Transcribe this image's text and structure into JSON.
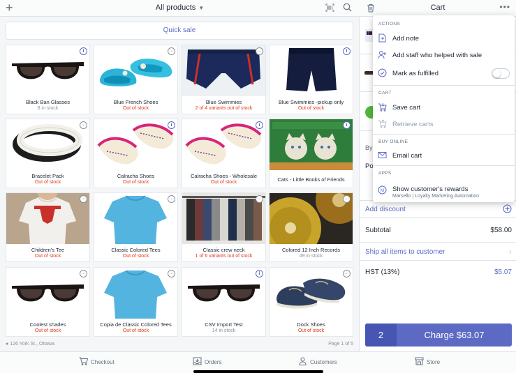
{
  "header": {
    "add_symbol": "+",
    "products_title": "All products",
    "caret": "▼"
  },
  "quick_sale_label": "Quick sale",
  "products": [
    {
      "name": "Black Ban Glasses",
      "stock": "8 in stock",
      "out": false,
      "badge": "info",
      "img": "sunglasses"
    },
    {
      "name": "Blue French Shoes",
      "stock": "Out of stock",
      "out": true,
      "badge": "more",
      "img": "blueshoes"
    },
    {
      "name": "Blue Swimmies",
      "stock": "2 of 4 variants out of stock",
      "out": true,
      "badge": "more",
      "img": "swimmies"
    },
    {
      "name": "Blue Swimmies -pickup only",
      "stock": "Out of stock",
      "out": true,
      "badge": "info",
      "img": "shorts"
    },
    {
      "name": "Bracelet Pack",
      "stock": "Out of stock",
      "out": true,
      "badge": "more",
      "img": "bracelet"
    },
    {
      "name": "Calracha Shoes",
      "stock": "Out of stock",
      "out": true,
      "badge": "info",
      "img": "pinkshoes"
    },
    {
      "name": "Calracha Shoes - Wholesale",
      "stock": "Out of stock",
      "out": true,
      "badge": "info",
      "img": "pinkshoes"
    },
    {
      "name": "Cats - Little Books of Friends",
      "stock": "",
      "out": false,
      "badge": "info",
      "img": "cats"
    },
    {
      "name": "Children's Tee",
      "stock": "Out of stock",
      "out": true,
      "badge": "more",
      "img": "tee"
    },
    {
      "name": "Classic Colored Tees",
      "stock": "Out of stock",
      "out": true,
      "badge": "more",
      "img": "bluetee"
    },
    {
      "name": "Classic crew neck",
      "stock": "1 of 6 variants out of stock",
      "out": true,
      "badge": "more",
      "img": "rack"
    },
    {
      "name": "Colored 12 Inch Records",
      "stock": "49 in stock",
      "out": false,
      "badge": "more",
      "img": "records"
    },
    {
      "name": "Coolest shades",
      "stock": "Out of stock",
      "out": true,
      "badge": "more",
      "img": "sunglasses"
    },
    {
      "name": "Copia de Classic Colored Tees",
      "stock": "Out of stock",
      "out": true,
      "badge": "more",
      "img": "bluetee"
    },
    {
      "name": "CSV Import Test",
      "stock": "14 in stock",
      "out": false,
      "badge": "info",
      "img": "sunglasses"
    },
    {
      "name": "Dock Shoes",
      "stock": "Out of stock",
      "out": true,
      "badge": "more",
      "img": "dockshoes"
    }
  ],
  "status": {
    "location": "126 York St., Ottawa",
    "page": "Page 1 of 5"
  },
  "cart": {
    "title": "Cart",
    "more": "•••",
    "partial_by": "By",
    "partial_po": "Po",
    "add_discount": "Add discount",
    "subtotal_label": "Subtotal",
    "subtotal_value": "$58.00",
    "ship_label": "Ship all items to customer",
    "tax_label": "HST (13%)",
    "tax_value": "$5.07",
    "quantity": "2",
    "charge_label": "Charge $63.07"
  },
  "menu": {
    "actions_header": "ACTIONS",
    "add_note": "Add note",
    "add_staff": "Add staff who helped with sale",
    "mark_fulfilled": "Mark as fulfilled",
    "mark_fulfilled_on": false,
    "cart_header": "CART",
    "save_cart": "Save cart",
    "retrieve_carts": "Retrieve carts",
    "buy_online_header": "BUY ONLINE",
    "email_cart": "Email cart",
    "apps_header": "APPS",
    "rewards": "Show customer's rewards",
    "rewards_sub": "Marsello | Loyalty Marketing Automation"
  },
  "tabs": {
    "checkout": "Checkout",
    "orders": "Orders",
    "customers": "Customers",
    "store": "Store"
  },
  "colors": {
    "accent": "#5c6ac4",
    "out_of_stock": "#de3618",
    "charge_button": "#5c6ac4",
    "quantity_box": "#4856b3",
    "partial_green": "#50b83c"
  }
}
